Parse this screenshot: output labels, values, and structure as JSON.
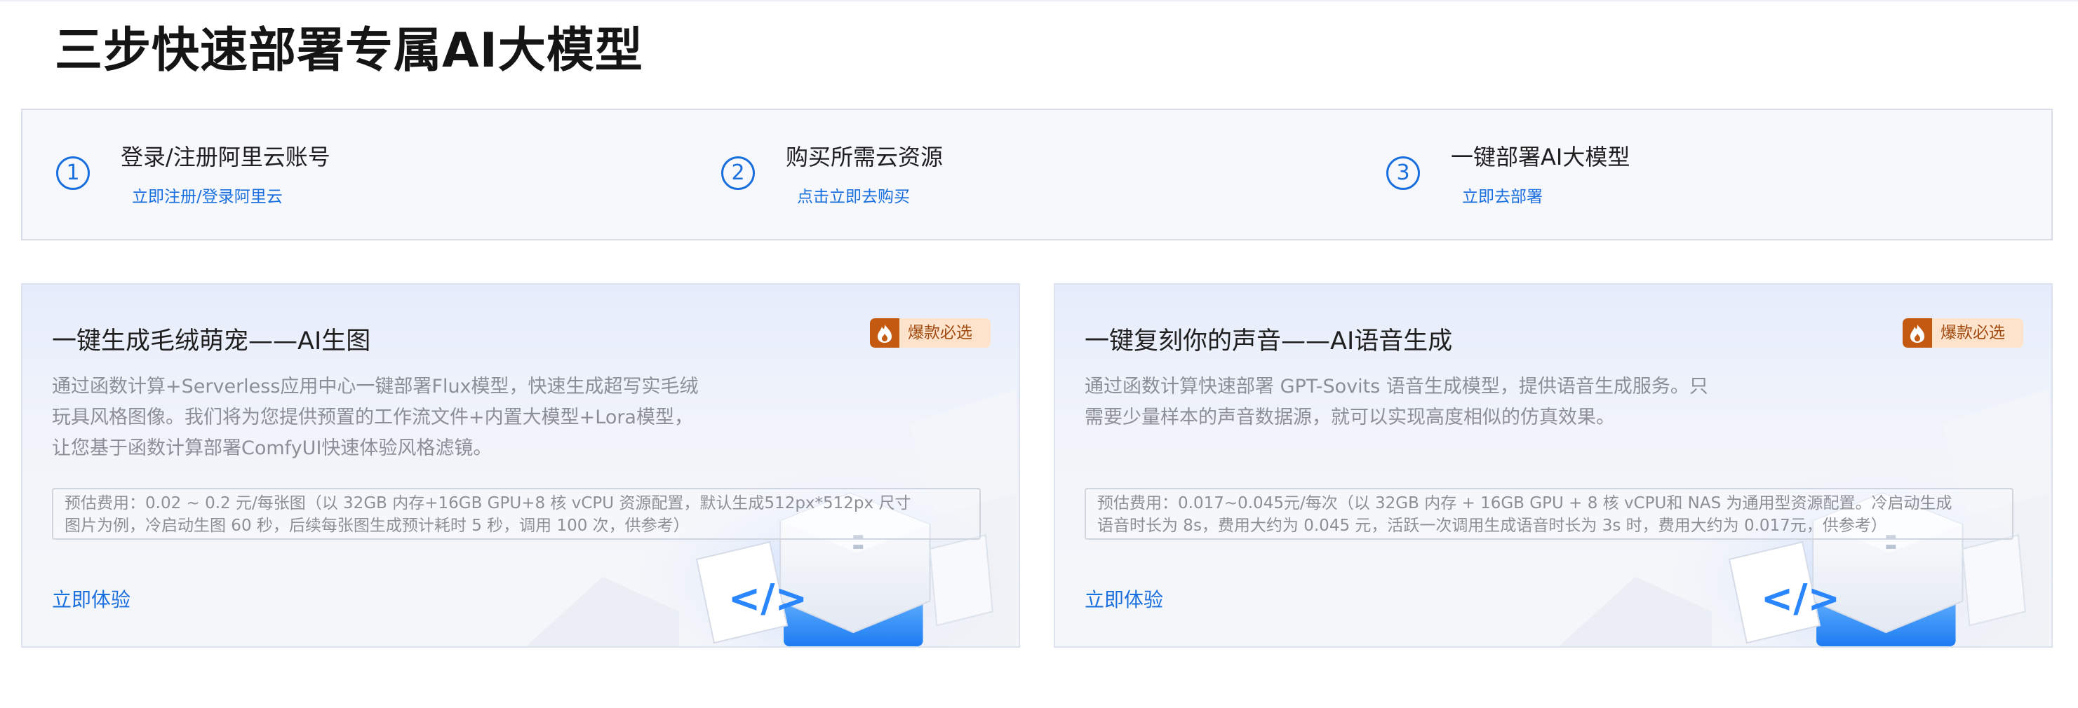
{
  "page": {
    "title": "三步快速部署专属AI大模型"
  },
  "steps": [
    {
      "num": "1",
      "title": "登录/注册阿里云账号",
      "link": "立即注册/登录阿里云"
    },
    {
      "num": "2",
      "title": "购买所需云资源",
      "link": "点击立即去购买"
    },
    {
      "num": "3",
      "title": "一键部署AI大模型",
      "link": "立即去部署"
    }
  ],
  "cards": [
    {
      "title": "一键生成毛绒萌宠——AI生图",
      "badge": "爆款必选",
      "desc": [
        "通过函数计算+Serverless应用中心一键部署Flux模型，快速生成超写实毛绒",
        "玩具风格图像。我们将为您提供预置的工作流文件+内置大模型+Lora模型，",
        "让您基于函数计算部署ComfyUI快速体验风格滤镜。"
      ],
      "cost": [
        "预估费用：0.02 ~ 0.2 元/每张图（以 32GB 内存+16GB GPU+8 核 vCPU 资源配置，默认生成512px*512px 尺寸",
        "图片为例，冷启动生图 60 秒，后续每张图生成预计耗时 5 秒，调用 100 次，供参考）"
      ],
      "cta": "立即体验"
    },
    {
      "title": "一键复刻你的声音——AI语音生成",
      "badge": "爆款必选",
      "desc": [
        "通过函数计算快速部署 GPT-Sovits 语音生成模型，提供语音生成服务。只",
        "需要少量样本的声音数据源，就可以实现高度相似的仿真效果。"
      ],
      "cost": [
        "预估费用：0.017~0.045元/每次（以 32GB 内存 + 16GB GPU + 8 核 vCPU和 NAS 为通用型资源配置。冷启动生成",
        "语音时长为 8s，费用大约为 0.045 元，活跃一次调用生成语音时长为 3s 时，费用大约为 0.017元，供参考）"
      ],
      "cta": "立即体验"
    }
  ],
  "colors": {
    "accent": "#1a6fdf",
    "badge_bg": "#fde3cc",
    "badge_text": "#a14a0f",
    "badge_icon": "#c45a12"
  },
  "icons": {
    "badge": "fire-icon",
    "art": "code-cube-illustration"
  }
}
